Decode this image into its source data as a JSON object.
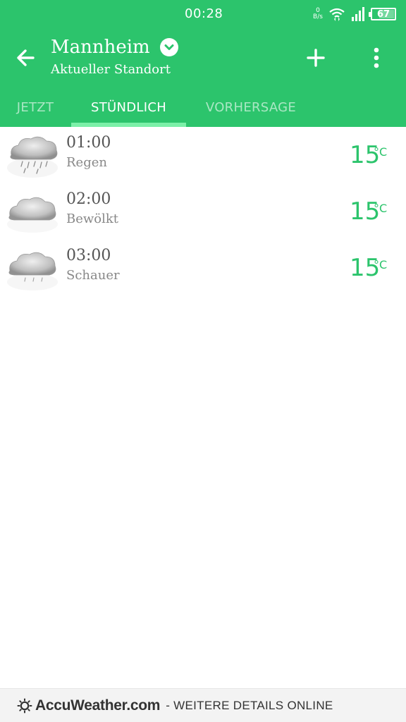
{
  "status_bar": {
    "time": "00:28",
    "net_speed_value": "0",
    "net_speed_unit": "B/s",
    "battery_level": "67",
    "battery_fraction": 0.67
  },
  "header": {
    "city": "Mannheim",
    "subtitle": "Aktueller Standort",
    "accent_color": "#2cc46c",
    "icons": {
      "back": "arrow-left-icon",
      "dropdown": "chevron-down-icon",
      "add": "plus-icon",
      "menu": "more-vertical-icon"
    }
  },
  "tabs": [
    {
      "label": "JETZT",
      "active": false
    },
    {
      "label": "STÜNDLICH",
      "active": true
    },
    {
      "label": "VORHERSAGE",
      "active": false
    }
  ],
  "hours": [
    {
      "time": "01:00",
      "condition": "Regen",
      "temp": "15",
      "unit": "°C",
      "icon": "rain-cloud-icon"
    },
    {
      "time": "02:00",
      "condition": "Bewölkt",
      "temp": "15",
      "unit": "°C",
      "icon": "cloudy-icon"
    },
    {
      "time": "03:00",
      "condition": "Schauer",
      "temp": "15",
      "unit": "°C",
      "icon": "showers-cloud-icon"
    }
  ],
  "footer": {
    "brand": "AccuWeather.com",
    "link_text": "- WEITERE DETAILS ONLINE",
    "icon": "sun-icon"
  }
}
